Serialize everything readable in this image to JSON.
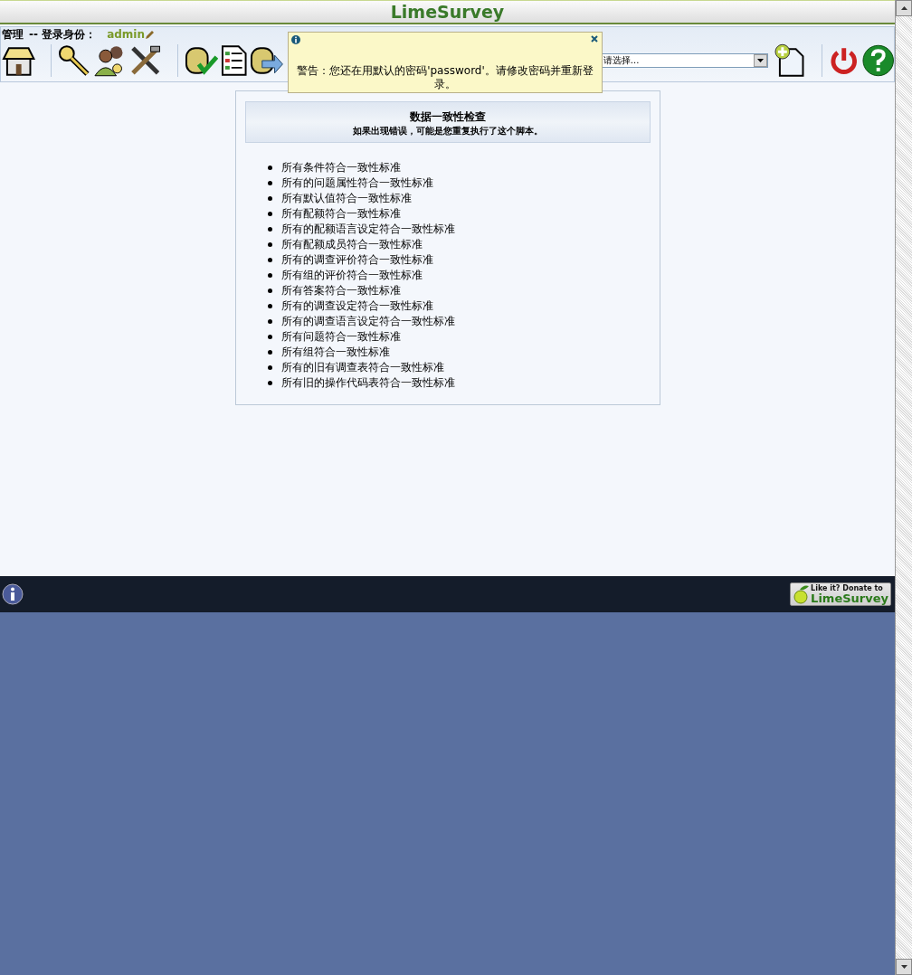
{
  "header": {
    "title": "LimeSurvey"
  },
  "admin_bar": {
    "label": "管理",
    "login_label": "-- 登录身份：",
    "user": "admin",
    "survey_select": {
      "value": "请选择..."
    }
  },
  "alert": {
    "message": "警告：您还在用默认的密码'password'。请修改密码并重新登录。"
  },
  "check_panel": {
    "title": "数据一致性检查",
    "subtitle": "如果出现错误，可能是您重复执行了这个脚本。",
    "results": [
      "所有条件符合一致性标准",
      "所有的问题属性符合一致性标准",
      "所有默认值符合一致性标准",
      "所有配额符合一致性标准",
      "所有的配额语言设定符合一致性标准",
      "所有配额成员符合一致性标准",
      "所有的调查评价符合一致性标准",
      "所有组的评价符合一致性标准",
      "所有答案符合一致性标准",
      "所有的调查设定符合一致性标准",
      "所有的调查语言设定符合一致性标准",
      "所有问题符合一致性标准",
      "所有组符合一致性标准",
      "所有的旧有调查表符合一致性标准",
      "所有旧的操作代码表符合一致性标准"
    ]
  },
  "footer": {
    "donate_line": "Like it? Donate to",
    "donate_brand": "LimeSurvey"
  }
}
